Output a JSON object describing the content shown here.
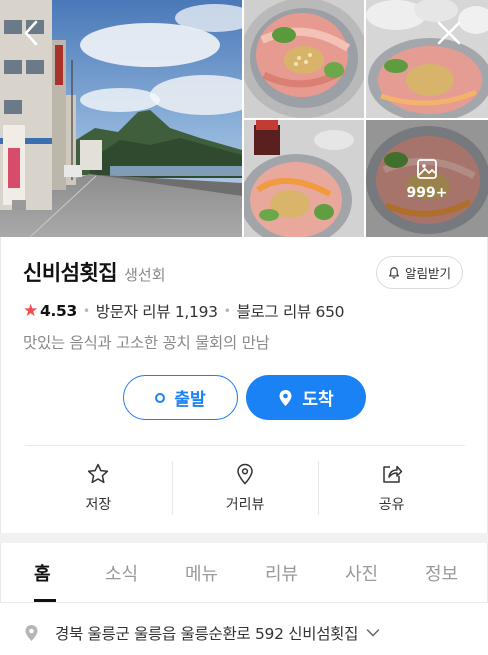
{
  "gallery": {
    "more_count": "999+"
  },
  "place": {
    "name": "신비섬횟집",
    "category": "생선회",
    "alarm_label": "알림받기",
    "rating": "4.53",
    "visitor_reviews": "방문자 리뷰 1,193",
    "blog_reviews": "블로그 리뷰 650",
    "description": "맛있는 음식과 고소한 꽁치 물회의 만남"
  },
  "buttons": {
    "depart": "출발",
    "arrive": "도착"
  },
  "actions": [
    {
      "label": "저장",
      "icon": "star-outline-icon"
    },
    {
      "label": "거리뷰",
      "icon": "location-pin-outline-icon"
    },
    {
      "label": "공유",
      "icon": "share-icon"
    }
  ],
  "tabs": [
    "홈",
    "소식",
    "메뉴",
    "리뷰",
    "사진",
    "정보"
  ],
  "active_tab": "홈",
  "address": "경북 울릉군 울릉읍 울릉순환로 592 신비섬횟집",
  "colors": {
    "accent": "#1b82f5",
    "star": "#f24c4c",
    "muted": "#8a8a8a"
  }
}
